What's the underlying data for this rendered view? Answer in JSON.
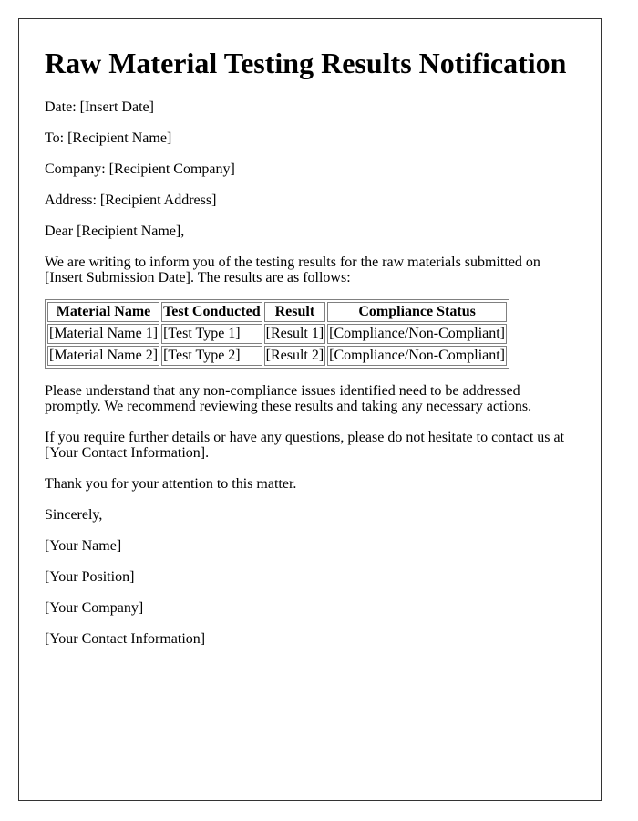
{
  "document": {
    "title": "Raw Material Testing Results Notification",
    "header_fields": [
      "Date: [Insert Date]",
      "To: [Recipient Name]",
      "Company: [Recipient Company]",
      "Address: [Recipient Address]"
    ],
    "salutation": "Dear [Recipient Name],",
    "intro_line1": "We are writing to inform you of the testing results for the raw materials submitted on",
    "intro_line2": "[Insert Submission Date]. The results are as follows:",
    "table": {
      "headers": [
        "Material Name",
        "Test Conducted",
        "Result",
        "Compliance Status"
      ],
      "rows": [
        [
          "[Material Name 1]",
          "[Test Type 1]",
          "[Result 1]",
          "[Compliance/Non-Compliant]"
        ],
        [
          "[Material Name 2]",
          "[Test Type 2]",
          "[Result 2]",
          "[Compliance/Non-Compliant]"
        ]
      ]
    },
    "notice_line1": "Please understand that any non-compliance issues identified need to be addressed",
    "notice_line2": "promptly. We recommend reviewing these results and taking any necessary actions.",
    "contact_line1": "If you require further details or have any questions, please do not hesitate to contact us at",
    "contact_line2": "[Your Contact Information].",
    "thanks": "Thank you for your attention to this matter.",
    "closing": "Sincerely,",
    "signature": [
      "[Your Name]",
      "[Your Position]",
      "[Your Company]",
      "[Your Contact Information]"
    ]
  }
}
